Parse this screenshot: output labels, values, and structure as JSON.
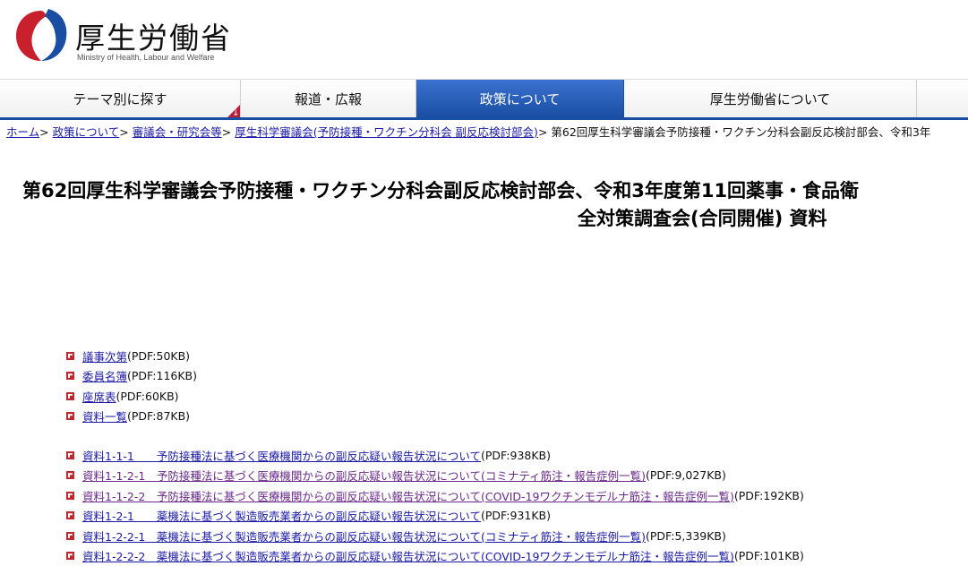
{
  "header": {
    "logo_text": "厚生労働省",
    "logo_sub": "Ministry of Health, Labour and Welfare",
    "colors": {
      "blue": "#1a4ea3",
      "red": "#c8202c"
    }
  },
  "nav": {
    "items": [
      {
        "label": "テーマ別に探す",
        "active": false
      },
      {
        "label": "報道・広報",
        "active": false
      },
      {
        "label": "政策について",
        "active": true
      },
      {
        "label": "厚生労働省について",
        "active": false
      }
    ]
  },
  "breadcrumb": {
    "links": [
      "ホーム",
      "政策について",
      "審議会・研究会等",
      "厚生科学審議会(予防接種・ワクチン分科会 副反応検討部会)"
    ],
    "separator": ">",
    "current": "第62回厚生科学審議会予防接種・ワクチン分科会副反応検討部会、令和3年"
  },
  "page_title": {
    "line1": "第62回厚生科学審議会予防接種・ワクチン分科会副反応検討部会、令和3年度第11回薬事・食品衛",
    "line2": "全対策調査会(合同開催) 資料"
  },
  "list_group1": [
    {
      "link": "議事次第",
      "size": "(PDF:50KB)",
      "visited": false
    },
    {
      "link": "委員名簿",
      "size": "(PDF:116KB)",
      "visited": false
    },
    {
      "link": "座席表",
      "size": "(PDF:60KB)",
      "visited": false
    },
    {
      "link": "資料一覧",
      "size": "(PDF:87KB)",
      "visited": false
    }
  ],
  "list_group2": [
    {
      "link": "資料1-1-1　　予防接種法に基づく医療機関からの副反応疑い報告状況について",
      "size": "(PDF:938KB)",
      "visited": false
    },
    {
      "link": "資料1-1-2-1　予防接種法に基づく医療機関からの副反応疑い報告状況について(コミナティ筋注・報告症例一覧)",
      "size": "(PDF:9,027KB)",
      "visited": true
    },
    {
      "link": "資料1-1-2-2　予防接種法に基づく医療機関からの副反応疑い報告状況について(COVID-19ワクチンモデルナ筋注・報告症例一覧)",
      "size": "(PDF:192KB)",
      "visited": true
    },
    {
      "link": "資料1-2-1　　薬機法に基づく製造販売業者からの副反応疑い報告状況について",
      "size": "(PDF:931KB)",
      "visited": false
    },
    {
      "link": "資料1-2-2-1　薬機法に基づく製造販売業者からの副反応疑い報告状況について(コミナティ筋注・報告症例一覧)",
      "size": "(PDF:5,339KB)",
      "visited": false
    },
    {
      "link": "資料1-2-2-2　薬機法に基づく製造販売業者からの副反応疑い報告状況について(COVID-19ワクチンモデルナ筋注・報告症例一覧)",
      "size": "(PDF:101KB)",
      "visited": false
    }
  ]
}
